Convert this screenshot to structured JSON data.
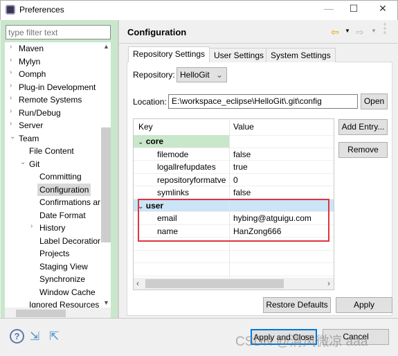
{
  "window": {
    "title": "Preferences",
    "minimize": "—",
    "maximize": "☐",
    "close": "✕"
  },
  "filter": {
    "placeholder": "type filter text"
  },
  "tree": [
    {
      "label": "Maven",
      "indent": 0,
      "chev": "›"
    },
    {
      "label": "Mylyn",
      "indent": 0,
      "chev": "›"
    },
    {
      "label": "Oomph",
      "indent": 0,
      "chev": "›"
    },
    {
      "label": "Plug-in Development",
      "indent": 0,
      "chev": "›"
    },
    {
      "label": "Remote Systems",
      "indent": 0,
      "chev": "›"
    },
    {
      "label": "Run/Debug",
      "indent": 0,
      "chev": "›"
    },
    {
      "label": "Server",
      "indent": 0,
      "chev": "›"
    },
    {
      "label": "Team",
      "indent": 0,
      "chev": "⌄"
    },
    {
      "label": "File Content",
      "indent": 1,
      "chev": ""
    },
    {
      "label": "Git",
      "indent": 1,
      "chev": "⌄"
    },
    {
      "label": "Committing",
      "indent": 2,
      "chev": ""
    },
    {
      "label": "Configuration",
      "indent": 2,
      "chev": "",
      "selected": true
    },
    {
      "label": "Confirmations ar",
      "indent": 2,
      "chev": ""
    },
    {
      "label": "Date Format",
      "indent": 2,
      "chev": ""
    },
    {
      "label": "History",
      "indent": 2,
      "chev": "›"
    },
    {
      "label": "Label Decoratior",
      "indent": 2,
      "chev": ""
    },
    {
      "label": "Projects",
      "indent": 2,
      "chev": ""
    },
    {
      "label": "Staging View",
      "indent": 2,
      "chev": ""
    },
    {
      "label": "Synchronize",
      "indent": 2,
      "chev": ""
    },
    {
      "label": "Window Cache",
      "indent": 2,
      "chev": ""
    },
    {
      "label": "Ignored Resources",
      "indent": 1,
      "chev": ""
    }
  ],
  "page": {
    "title": "Configuration"
  },
  "tabs": [
    "Repository Settings",
    "User Settings",
    "System Settings"
  ],
  "repository": {
    "label": "Repository:",
    "value": "HelloGit"
  },
  "location": {
    "label": "Location:",
    "value": "E:\\workspace_eclipse\\HelloGit\\.git\\config",
    "open": "Open"
  },
  "table": {
    "headers": [
      "Key",
      "Value"
    ],
    "rows": [
      {
        "key": "core",
        "value": "",
        "section": true,
        "color": "#c9e7cb"
      },
      {
        "key": "filemode",
        "value": "false"
      },
      {
        "key": "logallrefupdates",
        "value": "true"
      },
      {
        "key": "repositoryformatve",
        "value": "0"
      },
      {
        "key": "symlinks",
        "value": "false"
      },
      {
        "key": "user",
        "value": "",
        "section": true,
        "color": "#cce4f7"
      },
      {
        "key": "email",
        "value": "hybing@atguigu.com"
      },
      {
        "key": "name",
        "value": "HanZong666"
      }
    ]
  },
  "buttons": {
    "add_entry": "Add Entry...",
    "remove": "Remove",
    "restore_defaults": "Restore Defaults",
    "apply": "Apply",
    "apply_close": "Apply and Close",
    "cancel": "Cancel"
  },
  "watermark": "CSDN @清风微凉 aaa",
  "colors": {
    "accent": "#0078d7",
    "highlight": "#e0333d"
  }
}
